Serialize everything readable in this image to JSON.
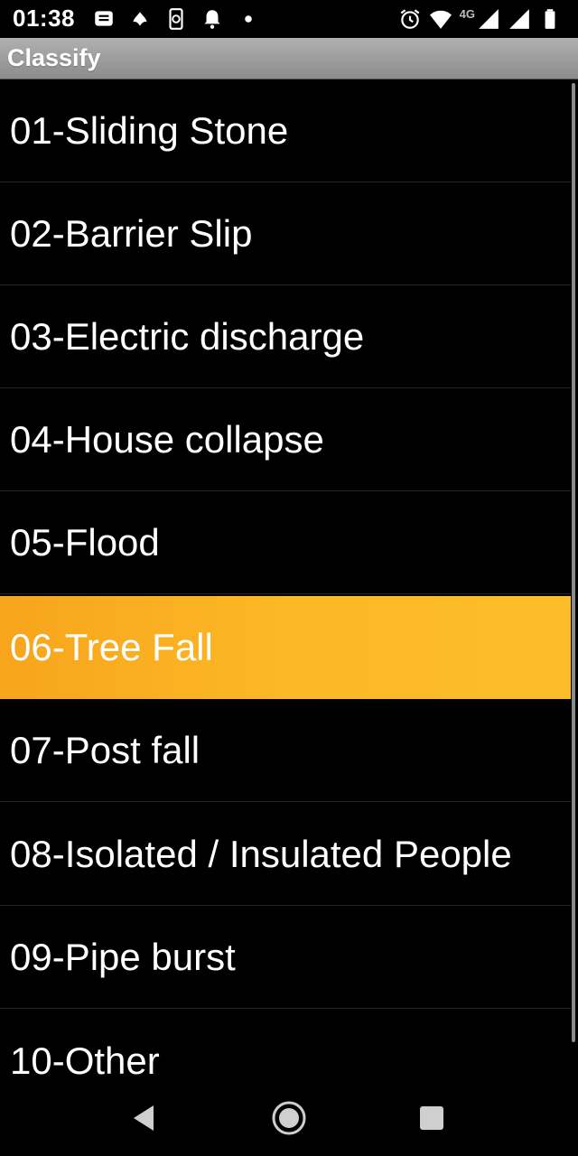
{
  "status_bar": {
    "time": "01:38",
    "network_label": "4G",
    "left_icons": [
      "message-icon",
      "app-notification-icon",
      "phone-sync-icon",
      "bell-icon",
      "dot-icon"
    ],
    "right_icons": [
      "alarm-icon",
      "wifi-icon",
      "signal-icon",
      "signal-icon",
      "battery-icon"
    ]
  },
  "app": {
    "title": "Classify"
  },
  "list": {
    "items": [
      {
        "label": "01-Sliding Stone",
        "selected": false
      },
      {
        "label": "02-Barrier Slip",
        "selected": false
      },
      {
        "label": "03-Electric discharge",
        "selected": false
      },
      {
        "label": "04-House collapse",
        "selected": false
      },
      {
        "label": "05-Flood",
        "selected": false
      },
      {
        "label": "06-Tree Fall",
        "selected": true
      },
      {
        "label": "07-Post fall",
        "selected": false
      },
      {
        "label": "08-Isolated / Insulated People",
        "selected": false
      },
      {
        "label": "09-Pipe burst",
        "selected": false
      },
      {
        "label": "10-Other",
        "selected": false
      }
    ],
    "selected_color": "#fcb826"
  },
  "nav_bar": {
    "buttons": [
      "back-icon",
      "home-icon",
      "recents-icon"
    ]
  }
}
